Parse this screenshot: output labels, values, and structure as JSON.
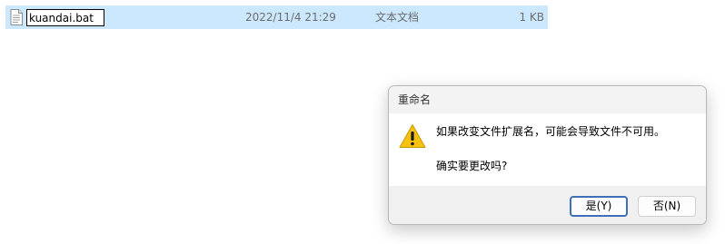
{
  "file_row": {
    "rename_value": "kuandai.bat",
    "date_modified": "2022/11/4 21:29",
    "type": "文本文档",
    "size": "1 KB",
    "icon": "text-file-icon",
    "selected_color": "#cce8ff"
  },
  "dialog": {
    "title": "重命名",
    "message": "如果改变文件扩展名，可能会导致文件不可用。",
    "question": "确实要更改吗?",
    "icon": "warning-icon",
    "buttons": {
      "yes_label": "是(Y)",
      "no_label": "否(N)"
    },
    "accent_color": "#3f6fb6"
  }
}
